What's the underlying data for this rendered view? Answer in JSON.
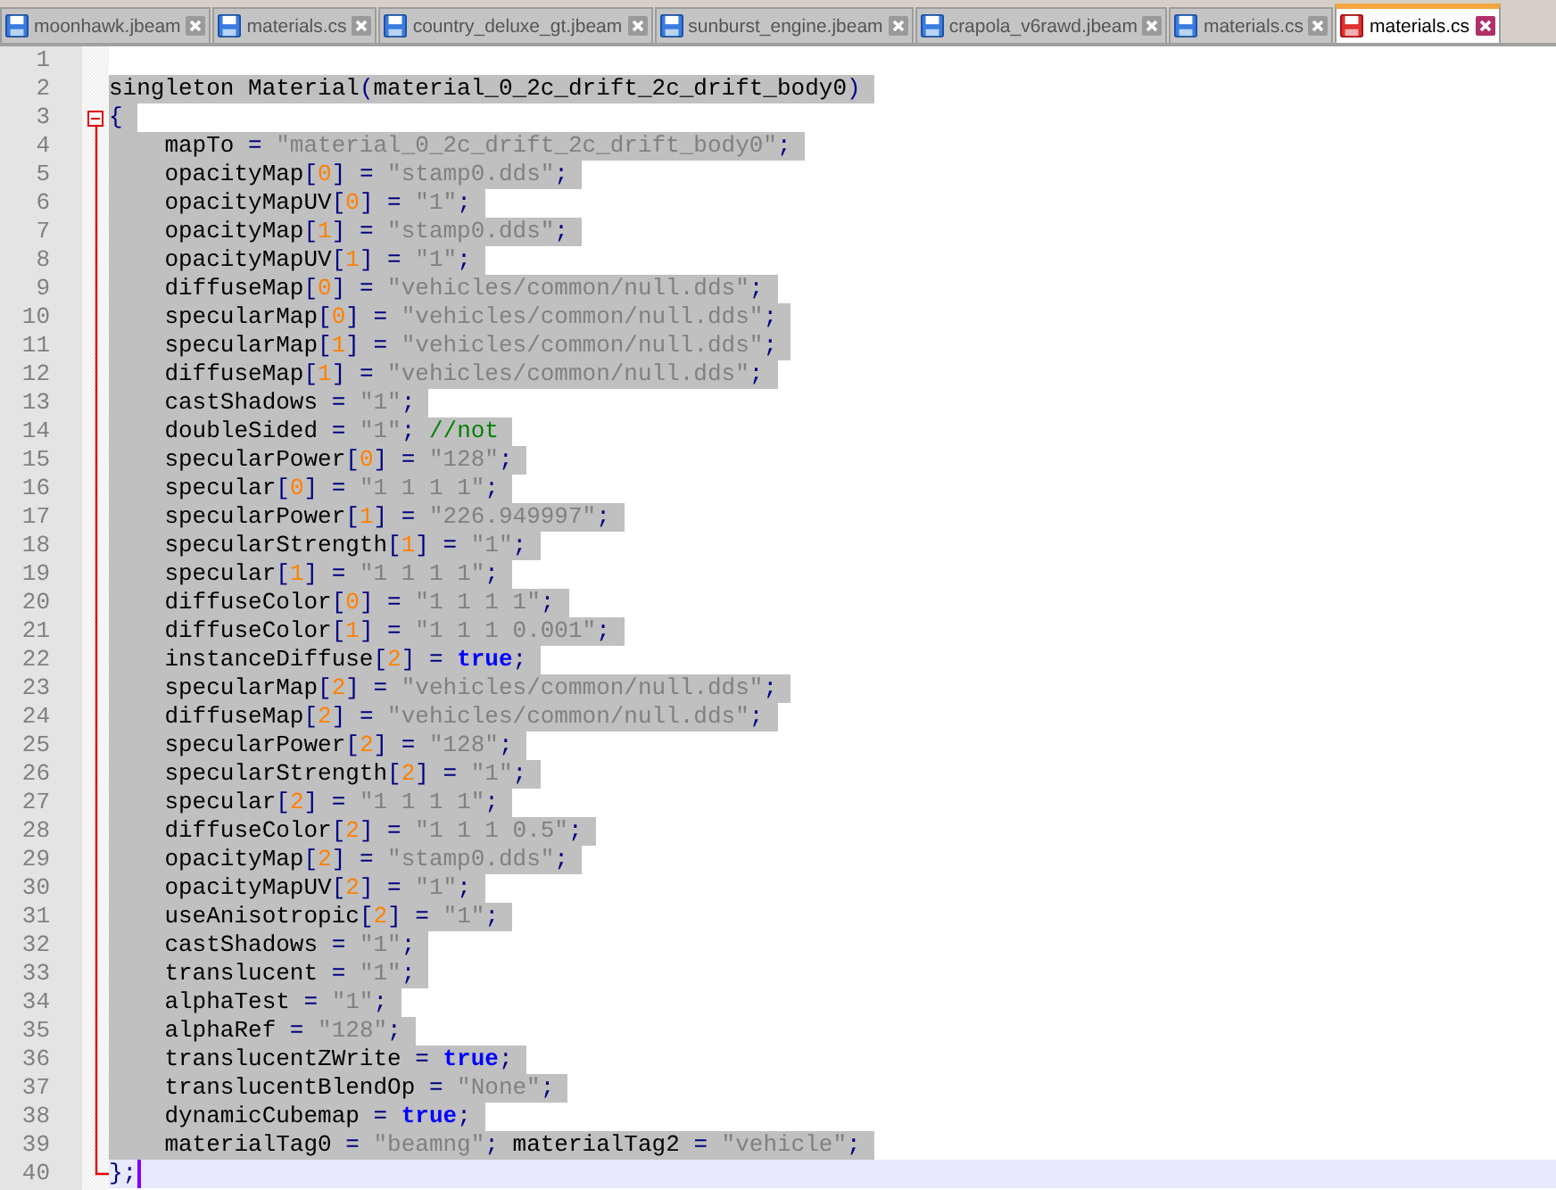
{
  "tabs": [
    {
      "label": "moonhawk.jbeam",
      "selected": false,
      "modified": false
    },
    {
      "label": "materials.cs",
      "selected": false,
      "modified": false
    },
    {
      "label": "country_deluxe_gt.jbeam",
      "selected": false,
      "modified": false
    },
    {
      "label": "sunburst_engine.jbeam",
      "selected": false,
      "modified": false
    },
    {
      "label": "crapola_v6rawd.jbeam",
      "selected": false,
      "modified": false
    },
    {
      "label": "materials.cs",
      "selected": false,
      "modified": false
    },
    {
      "label": "materials.cs",
      "selected": true,
      "modified": true
    }
  ],
  "lines": [
    {
      "number": "1",
      "selected": false,
      "current": false
    },
    {
      "number": "2",
      "selected": true,
      "current": false,
      "tokens": [
        {
          "kind": "plain",
          "text": "singleton Material"
        },
        {
          "kind": "op",
          "text": "("
        },
        {
          "kind": "plain",
          "text": "material_0_2c_drift_2c_drift_body0"
        },
        {
          "kind": "op",
          "text": ")"
        }
      ]
    },
    {
      "number": "3",
      "selected": true,
      "current": false,
      "fold_start": true,
      "tokens": [
        {
          "kind": "op",
          "text": "{"
        }
      ]
    },
    {
      "number": "4",
      "selected": true,
      "current": false,
      "tokens": [
        {
          "kind": "plain",
          "text": "    mapTo "
        },
        {
          "kind": "op",
          "text": "="
        },
        {
          "kind": "str",
          "text": " \"material_0_2c_drift_2c_drift_body0\""
        },
        {
          "kind": "op",
          "text": ";"
        }
      ]
    },
    {
      "number": "5",
      "selected": true,
      "current": false,
      "tokens": [
        {
          "kind": "plain",
          "text": "    opacityMap"
        },
        {
          "kind": "op",
          "text": "["
        },
        {
          "kind": "num",
          "text": "0"
        },
        {
          "kind": "op",
          "text": "] ="
        },
        {
          "kind": "str",
          "text": " \"stamp0.dds\""
        },
        {
          "kind": "op",
          "text": ";"
        }
      ]
    },
    {
      "number": "6",
      "selected": true,
      "current": false,
      "tokens": [
        {
          "kind": "plain",
          "text": "    opacityMapUV"
        },
        {
          "kind": "op",
          "text": "["
        },
        {
          "kind": "num",
          "text": "0"
        },
        {
          "kind": "op",
          "text": "] ="
        },
        {
          "kind": "str",
          "text": " \"1\""
        },
        {
          "kind": "op",
          "text": ";"
        }
      ]
    },
    {
      "number": "7",
      "selected": true,
      "current": false,
      "tokens": [
        {
          "kind": "plain",
          "text": "    opacityMap"
        },
        {
          "kind": "op",
          "text": "["
        },
        {
          "kind": "num",
          "text": "1"
        },
        {
          "kind": "op",
          "text": "] ="
        },
        {
          "kind": "str",
          "text": " \"stamp0.dds\""
        },
        {
          "kind": "op",
          "text": ";"
        }
      ]
    },
    {
      "number": "8",
      "selected": true,
      "current": false,
      "tokens": [
        {
          "kind": "plain",
          "text": "    opacityMapUV"
        },
        {
          "kind": "op",
          "text": "["
        },
        {
          "kind": "num",
          "text": "1"
        },
        {
          "kind": "op",
          "text": "] ="
        },
        {
          "kind": "str",
          "text": " \"1\""
        },
        {
          "kind": "op",
          "text": ";"
        }
      ]
    },
    {
      "number": "9",
      "selected": true,
      "current": false,
      "tokens": [
        {
          "kind": "plain",
          "text": "    diffuseMap"
        },
        {
          "kind": "op",
          "text": "["
        },
        {
          "kind": "num",
          "text": "0"
        },
        {
          "kind": "op",
          "text": "] ="
        },
        {
          "kind": "str",
          "text": " \"vehicles/common/null.dds\""
        },
        {
          "kind": "op",
          "text": ";"
        }
      ]
    },
    {
      "number": "10",
      "selected": true,
      "current": false,
      "tokens": [
        {
          "kind": "plain",
          "text": "    specularMap"
        },
        {
          "kind": "op",
          "text": "["
        },
        {
          "kind": "num",
          "text": "0"
        },
        {
          "kind": "op",
          "text": "] ="
        },
        {
          "kind": "str",
          "text": " \"vehicles/common/null.dds\""
        },
        {
          "kind": "op",
          "text": ";"
        }
      ]
    },
    {
      "number": "11",
      "selected": true,
      "current": false,
      "tokens": [
        {
          "kind": "plain",
          "text": "    specularMap"
        },
        {
          "kind": "op",
          "text": "["
        },
        {
          "kind": "num",
          "text": "1"
        },
        {
          "kind": "op",
          "text": "] ="
        },
        {
          "kind": "str",
          "text": " \"vehicles/common/null.dds\""
        },
        {
          "kind": "op",
          "text": ";"
        }
      ]
    },
    {
      "number": "12",
      "selected": true,
      "current": false,
      "tokens": [
        {
          "kind": "plain",
          "text": "    diffuseMap"
        },
        {
          "kind": "op",
          "text": "["
        },
        {
          "kind": "num",
          "text": "1"
        },
        {
          "kind": "op",
          "text": "] ="
        },
        {
          "kind": "str",
          "text": " \"vehicles/common/null.dds\""
        },
        {
          "kind": "op",
          "text": ";"
        }
      ]
    },
    {
      "number": "13",
      "selected": true,
      "current": false,
      "tokens": [
        {
          "kind": "plain",
          "text": "    castShadows "
        },
        {
          "kind": "op",
          "text": "="
        },
        {
          "kind": "str",
          "text": " \"1\""
        },
        {
          "kind": "op",
          "text": ";"
        }
      ]
    },
    {
      "number": "14",
      "selected": true,
      "current": false,
      "tokens": [
        {
          "kind": "plain",
          "text": "    doubleSided "
        },
        {
          "kind": "op",
          "text": "="
        },
        {
          "kind": "str",
          "text": " \"1\""
        },
        {
          "kind": "op",
          "text": ";"
        },
        {
          "kind": "comment",
          "text": " //not"
        }
      ]
    },
    {
      "number": "15",
      "selected": true,
      "current": false,
      "tokens": [
        {
          "kind": "plain",
          "text": "    specularPower"
        },
        {
          "kind": "op",
          "text": "["
        },
        {
          "kind": "num",
          "text": "0"
        },
        {
          "kind": "op",
          "text": "] ="
        },
        {
          "kind": "str",
          "text": " \"128\""
        },
        {
          "kind": "op",
          "text": ";"
        }
      ]
    },
    {
      "number": "16",
      "selected": true,
      "current": false,
      "tokens": [
        {
          "kind": "plain",
          "text": "    specular"
        },
        {
          "kind": "op",
          "text": "["
        },
        {
          "kind": "num",
          "text": "0"
        },
        {
          "kind": "op",
          "text": "] ="
        },
        {
          "kind": "str",
          "text": " \"1 1 1 1\""
        },
        {
          "kind": "op",
          "text": ";"
        }
      ]
    },
    {
      "number": "17",
      "selected": true,
      "current": false,
      "tokens": [
        {
          "kind": "plain",
          "text": "    specularPower"
        },
        {
          "kind": "op",
          "text": "["
        },
        {
          "kind": "num",
          "text": "1"
        },
        {
          "kind": "op",
          "text": "] ="
        },
        {
          "kind": "str",
          "text": " \"226.949997\""
        },
        {
          "kind": "op",
          "text": ";"
        }
      ]
    },
    {
      "number": "18",
      "selected": true,
      "current": false,
      "tokens": [
        {
          "kind": "plain",
          "text": "    specularStrength"
        },
        {
          "kind": "op",
          "text": "["
        },
        {
          "kind": "num",
          "text": "1"
        },
        {
          "kind": "op",
          "text": "] ="
        },
        {
          "kind": "str",
          "text": " \"1\""
        },
        {
          "kind": "op",
          "text": ";"
        }
      ]
    },
    {
      "number": "19",
      "selected": true,
      "current": false,
      "tokens": [
        {
          "kind": "plain",
          "text": "    specular"
        },
        {
          "kind": "op",
          "text": "["
        },
        {
          "kind": "num",
          "text": "1"
        },
        {
          "kind": "op",
          "text": "] ="
        },
        {
          "kind": "str",
          "text": " \"1 1 1 1\""
        },
        {
          "kind": "op",
          "text": ";"
        }
      ]
    },
    {
      "number": "20",
      "selected": true,
      "current": false,
      "tokens": [
        {
          "kind": "plain",
          "text": "    diffuseColor"
        },
        {
          "kind": "op",
          "text": "["
        },
        {
          "kind": "num",
          "text": "0"
        },
        {
          "kind": "op",
          "text": "] ="
        },
        {
          "kind": "str",
          "text": " \"1 1 1 1\""
        },
        {
          "kind": "op",
          "text": ";"
        }
      ]
    },
    {
      "number": "21",
      "selected": true,
      "current": false,
      "tokens": [
        {
          "kind": "plain",
          "text": "    diffuseColor"
        },
        {
          "kind": "op",
          "text": "["
        },
        {
          "kind": "num",
          "text": "1"
        },
        {
          "kind": "op",
          "text": "] ="
        },
        {
          "kind": "str",
          "text": " \"1 1 1 0.001\""
        },
        {
          "kind": "op",
          "text": ";"
        }
      ]
    },
    {
      "number": "22",
      "selected": true,
      "current": false,
      "tokens": [
        {
          "kind": "plain",
          "text": "    instanceDiffuse"
        },
        {
          "kind": "op",
          "text": "["
        },
        {
          "kind": "num",
          "text": "2"
        },
        {
          "kind": "op",
          "text": "] = "
        },
        {
          "kind": "kw",
          "text": "true"
        },
        {
          "kind": "op",
          "text": ";"
        }
      ]
    },
    {
      "number": "23",
      "selected": true,
      "current": false,
      "tokens": [
        {
          "kind": "plain",
          "text": "    specularMap"
        },
        {
          "kind": "op",
          "text": "["
        },
        {
          "kind": "num",
          "text": "2"
        },
        {
          "kind": "op",
          "text": "] ="
        },
        {
          "kind": "str",
          "text": " \"vehicles/common/null.dds\""
        },
        {
          "kind": "op",
          "text": ";"
        }
      ]
    },
    {
      "number": "24",
      "selected": true,
      "current": false,
      "tokens": [
        {
          "kind": "plain",
          "text": "    diffuseMap"
        },
        {
          "kind": "op",
          "text": "["
        },
        {
          "kind": "num",
          "text": "2"
        },
        {
          "kind": "op",
          "text": "] ="
        },
        {
          "kind": "str",
          "text": " \"vehicles/common/null.dds\""
        },
        {
          "kind": "op",
          "text": ";"
        }
      ]
    },
    {
      "number": "25",
      "selected": true,
      "current": false,
      "tokens": [
        {
          "kind": "plain",
          "text": "    specularPower"
        },
        {
          "kind": "op",
          "text": "["
        },
        {
          "kind": "num",
          "text": "2"
        },
        {
          "kind": "op",
          "text": "] ="
        },
        {
          "kind": "str",
          "text": " \"128\""
        },
        {
          "kind": "op",
          "text": ";"
        }
      ]
    },
    {
      "number": "26",
      "selected": true,
      "current": false,
      "tokens": [
        {
          "kind": "plain",
          "text": "    specularStrength"
        },
        {
          "kind": "op",
          "text": "["
        },
        {
          "kind": "num",
          "text": "2"
        },
        {
          "kind": "op",
          "text": "] ="
        },
        {
          "kind": "str",
          "text": " \"1\""
        },
        {
          "kind": "op",
          "text": ";"
        }
      ]
    },
    {
      "number": "27",
      "selected": true,
      "current": false,
      "tokens": [
        {
          "kind": "plain",
          "text": "    specular"
        },
        {
          "kind": "op",
          "text": "["
        },
        {
          "kind": "num",
          "text": "2"
        },
        {
          "kind": "op",
          "text": "] ="
        },
        {
          "kind": "str",
          "text": " \"1 1 1 1\""
        },
        {
          "kind": "op",
          "text": ";"
        }
      ]
    },
    {
      "number": "28",
      "selected": true,
      "current": false,
      "tokens": [
        {
          "kind": "plain",
          "text": "    diffuseColor"
        },
        {
          "kind": "op",
          "text": "["
        },
        {
          "kind": "num",
          "text": "2"
        },
        {
          "kind": "op",
          "text": "] ="
        },
        {
          "kind": "str",
          "text": " \"1 1 1 0.5\""
        },
        {
          "kind": "op",
          "text": ";"
        }
      ]
    },
    {
      "number": "29",
      "selected": true,
      "current": false,
      "tokens": [
        {
          "kind": "plain",
          "text": "    opacityMap"
        },
        {
          "kind": "op",
          "text": "["
        },
        {
          "kind": "num",
          "text": "2"
        },
        {
          "kind": "op",
          "text": "] ="
        },
        {
          "kind": "str",
          "text": " \"stamp0.dds\""
        },
        {
          "kind": "op",
          "text": ";"
        }
      ]
    },
    {
      "number": "30",
      "selected": true,
      "current": false,
      "tokens": [
        {
          "kind": "plain",
          "text": "    opacityMapUV"
        },
        {
          "kind": "op",
          "text": "["
        },
        {
          "kind": "num",
          "text": "2"
        },
        {
          "kind": "op",
          "text": "] ="
        },
        {
          "kind": "str",
          "text": " \"1\""
        },
        {
          "kind": "op",
          "text": ";"
        }
      ]
    },
    {
      "number": "31",
      "selected": true,
      "current": false,
      "tokens": [
        {
          "kind": "plain",
          "text": "    useAnisotropic"
        },
        {
          "kind": "op",
          "text": "["
        },
        {
          "kind": "num",
          "text": "2"
        },
        {
          "kind": "op",
          "text": "] ="
        },
        {
          "kind": "str",
          "text": " \"1\""
        },
        {
          "kind": "op",
          "text": ";"
        }
      ]
    },
    {
      "number": "32",
      "selected": true,
      "current": false,
      "tokens": [
        {
          "kind": "plain",
          "text": "    castShadows "
        },
        {
          "kind": "op",
          "text": "="
        },
        {
          "kind": "str",
          "text": " \"1\""
        },
        {
          "kind": "op",
          "text": ";"
        }
      ]
    },
    {
      "number": "33",
      "selected": true,
      "current": false,
      "tokens": [
        {
          "kind": "plain",
          "text": "    translucent "
        },
        {
          "kind": "op",
          "text": "="
        },
        {
          "kind": "str",
          "text": " \"1\""
        },
        {
          "kind": "op",
          "text": ";"
        }
      ]
    },
    {
      "number": "34",
      "selected": true,
      "current": false,
      "tokens": [
        {
          "kind": "plain",
          "text": "    alphaTest "
        },
        {
          "kind": "op",
          "text": "="
        },
        {
          "kind": "str",
          "text": " \"1\""
        },
        {
          "kind": "op",
          "text": ";"
        }
      ]
    },
    {
      "number": "35",
      "selected": true,
      "current": false,
      "tokens": [
        {
          "kind": "plain",
          "text": "    alphaRef "
        },
        {
          "kind": "op",
          "text": "="
        },
        {
          "kind": "str",
          "text": " \"128\""
        },
        {
          "kind": "op",
          "text": ";"
        }
      ]
    },
    {
      "number": "36",
      "selected": true,
      "current": false,
      "tokens": [
        {
          "kind": "plain",
          "text": "    translucentZWrite "
        },
        {
          "kind": "op",
          "text": "= "
        },
        {
          "kind": "kw",
          "text": "true"
        },
        {
          "kind": "op",
          "text": ";"
        }
      ]
    },
    {
      "number": "37",
      "selected": true,
      "current": false,
      "tokens": [
        {
          "kind": "plain",
          "text": "    translucentBlendOp "
        },
        {
          "kind": "op",
          "text": "="
        },
        {
          "kind": "str",
          "text": " \"None\""
        },
        {
          "kind": "op",
          "text": ";"
        }
      ]
    },
    {
      "number": "38",
      "selected": true,
      "current": false,
      "tokens": [
        {
          "kind": "plain",
          "text": "    dynamicCubemap "
        },
        {
          "kind": "op",
          "text": "= "
        },
        {
          "kind": "kw",
          "text": "true"
        },
        {
          "kind": "op",
          "text": ";"
        }
      ]
    },
    {
      "number": "39",
      "selected": true,
      "current": false,
      "tokens": [
        {
          "kind": "plain",
          "text": "    materialTag0 "
        },
        {
          "kind": "op",
          "text": "="
        },
        {
          "kind": "str",
          "text": " \"beamng\""
        },
        {
          "kind": "op",
          "text": ";"
        },
        {
          "kind": "plain",
          "text": " materialTag2 "
        },
        {
          "kind": "op",
          "text": "="
        },
        {
          "kind": "str",
          "text": " \"vehicle\""
        },
        {
          "kind": "op",
          "text": ";"
        }
      ]
    },
    {
      "number": "40",
      "selected": false,
      "current": true,
      "fold_end": true,
      "tokens": [
        {
          "kind": "op",
          "text": "};"
        }
      ]
    }
  ]
}
